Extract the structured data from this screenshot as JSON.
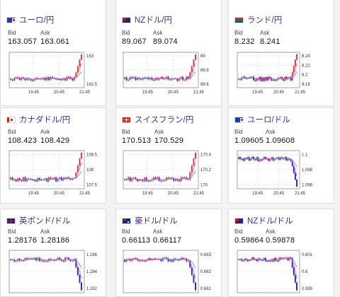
{
  "labels": {
    "bid": "Bid",
    "ask": "Ask"
  },
  "colors": {
    "up": "#e23b3b",
    "down": "#2b2bd3",
    "ma_short": "#ff4fb0",
    "ma_long": "#4a9ad8",
    "grid": "#bdbdbd",
    "title": "#4b2a8c"
  },
  "cards": [
    {
      "title": "ユーロ/円",
      "flag": "eu-flag-icon",
      "bid": "163.057",
      "ask": "163.061",
      "chart_data": {
        "type": "candlestick",
        "x_ticks": [
          "19:45",
          "20:45",
          "21:45"
        ],
        "y_ticks": [
          "163",
          "162.5"
        ],
        "trend": "spike-up"
      }
    },
    {
      "title": "NZドル/円",
      "flag": "nz-flag-icon",
      "bid": "89.067",
      "ask": "89.074",
      "chart_data": {
        "type": "candlestick",
        "x_ticks": [
          "19:45",
          "20:45",
          "21:45"
        ],
        "y_ticks": [
          "89",
          "88.8",
          "88.6"
        ],
        "trend": "spike-up"
      }
    },
    {
      "title": "ランド/円",
      "flag": "za-flag-icon",
      "bid": "8.232",
      "ask": "8.241",
      "chart_data": {
        "type": "candlestick",
        "x_ticks": [
          "19:45",
          "20:45",
          "21:45"
        ],
        "y_ticks": [
          "8.24",
          "8.22",
          "8.2",
          "8.18"
        ],
        "trend": "spike-up"
      }
    },
    {
      "title": "カナダドル/円",
      "flag": "ca-flag-icon",
      "bid": "108.423",
      "ask": "108.429",
      "chart_data": {
        "type": "candlestick",
        "x_ticks": [
          "19:45",
          "20:45",
          "21:45"
        ],
        "y_ticks": [
          "108.5",
          "108",
          "107.5"
        ],
        "trend": "spike-up"
      }
    },
    {
      "title": "スイスフラン/円",
      "flag": "ch-flag-icon",
      "bid": "170.513",
      "ask": "170.529",
      "chart_data": {
        "type": "candlestick",
        "x_ticks": [
          "19:45",
          "20:45",
          "21:45"
        ],
        "y_ticks": [
          "170.4",
          "170.2",
          "170"
        ],
        "trend": "spike-up"
      }
    },
    {
      "title": "ユーロ/ドル",
      "flag": "us-flag-icon",
      "bid": "1.09605",
      "ask": "1.09608",
      "chart_data": {
        "type": "candlestick",
        "x_ticks": [
          "19:45",
          "20:45",
          "21:45"
        ],
        "y_ticks": [
          "1.1",
          "1.098",
          "1.096"
        ],
        "trend": "spike-down"
      }
    },
    {
      "title": "英ポンド/ドル",
      "flag": "us-flag-icon",
      "bid": "1.28176",
      "ask": "1.28186",
      "chart_data": {
        "type": "candlestick",
        "x_ticks": [],
        "y_ticks": [
          "1.286",
          "1.284",
          "1.282"
        ],
        "trend": "spike-down"
      }
    },
    {
      "title": "豪ドル/ドル",
      "flag": "us-flag-icon",
      "bid": "0.66113",
      "ask": "0.66117",
      "chart_data": {
        "type": "candlestick",
        "x_ticks": [],
        "y_ticks": [
          "0.663",
          "0.662",
          "0.661"
        ],
        "trend": "spike-down"
      }
    },
    {
      "title": "NZドル/ドル",
      "flag": "us-flag-icon",
      "bid": "0.59864",
      "ask": "0.59878",
      "chart_data": {
        "type": "candlestick",
        "x_ticks": [],
        "y_ticks": [
          "0.601",
          "0.6",
          "0.599"
        ],
        "trend": "spike-down"
      }
    }
  ]
}
